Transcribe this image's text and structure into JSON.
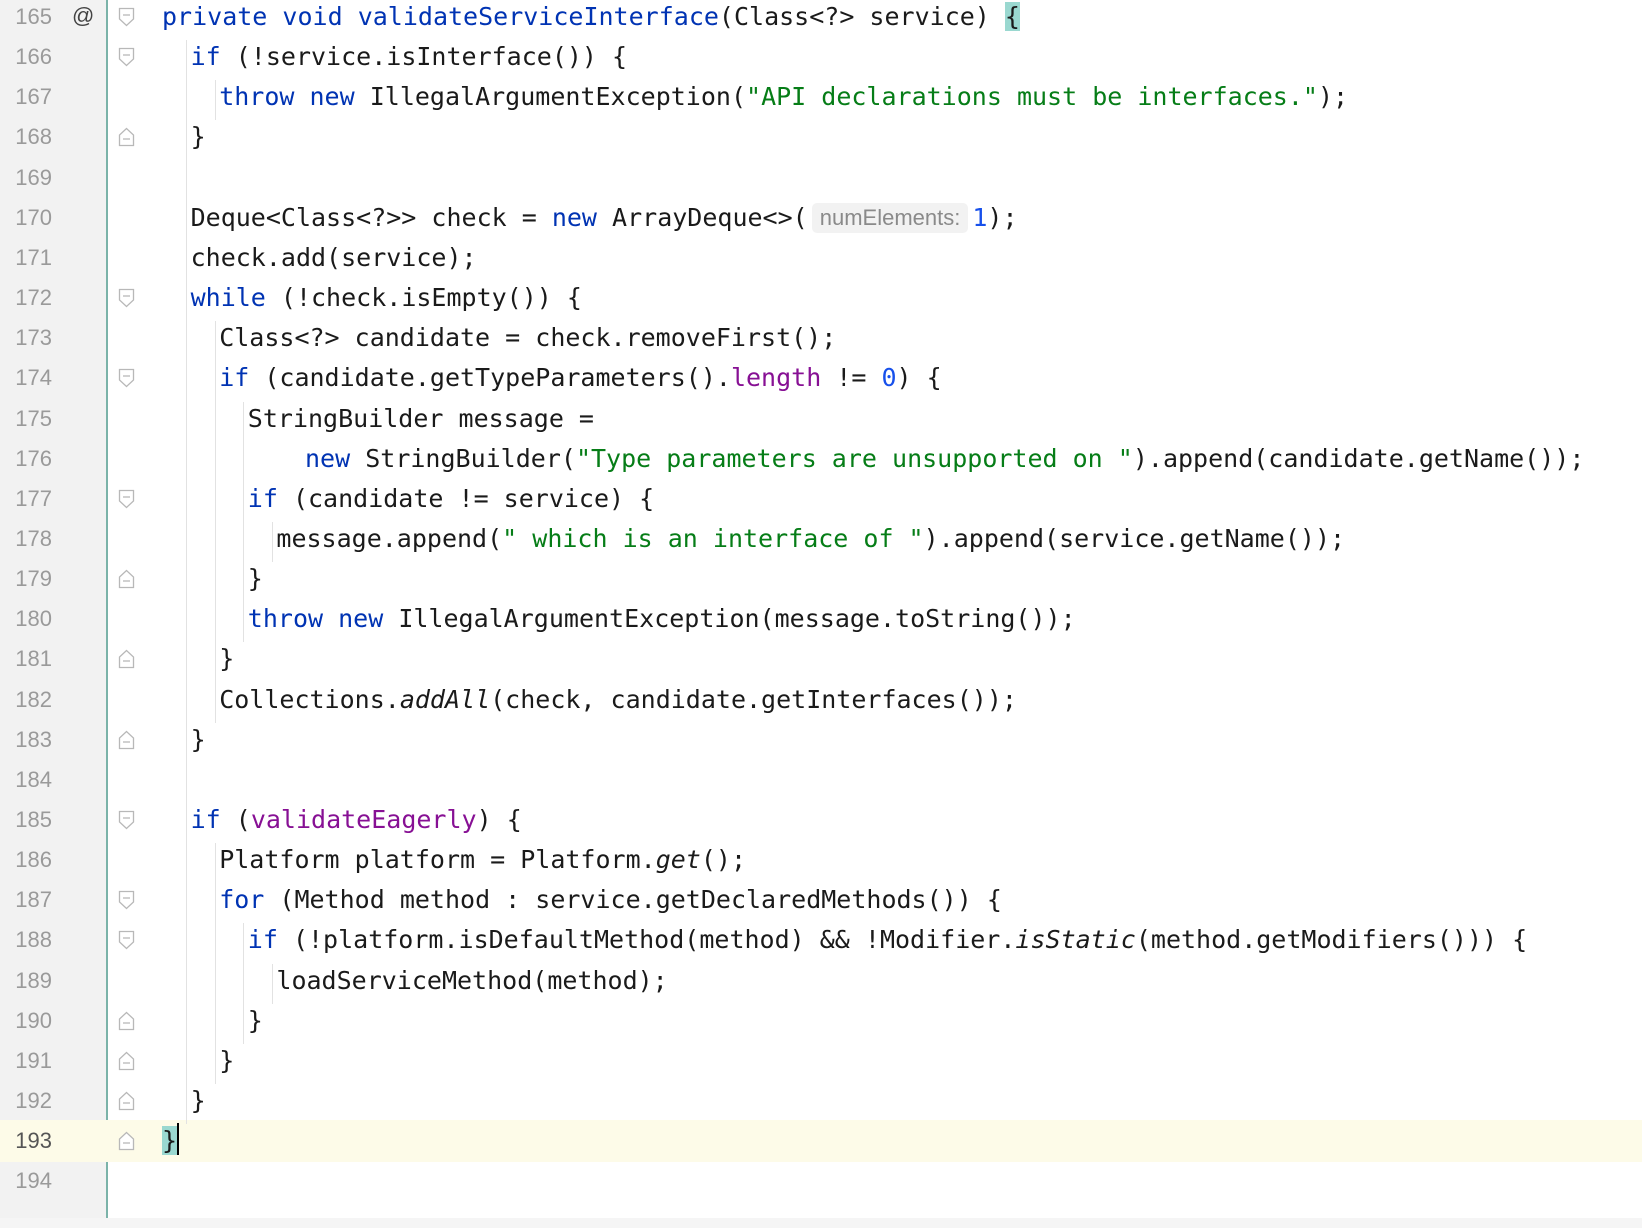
{
  "editor": {
    "lines": [
      {
        "no": "165",
        "marker": "@",
        "fold": "open",
        "indent": 0,
        "code": [
          [
            "kw",
            "private "
          ],
          [
            "kw",
            "void "
          ],
          [
            "fn",
            "validateServiceInterface"
          ],
          [
            "",
            "(Class<?> service) "
          ],
          [
            "hl",
            "{"
          ]
        ]
      },
      {
        "no": "166",
        "fold": "open",
        "indent": 1,
        "code": [
          [
            "kw",
            "if "
          ],
          [
            "",
            "(!service.isInterface()) {"
          ]
        ]
      },
      {
        "no": "167",
        "indent": 2,
        "code": [
          [
            "kw",
            "throw "
          ],
          [
            "kw",
            "new "
          ],
          [
            "",
            "IllegalArgumentException("
          ],
          [
            "str",
            "\"API declarations must be interfaces.\""
          ],
          [
            "",
            ");"
          ]
        ]
      },
      {
        "no": "168",
        "fold": "close",
        "indent": 1,
        "code": [
          [
            "",
            "}"
          ]
        ]
      },
      {
        "no": "169",
        "indent": 0,
        "code": []
      },
      {
        "no": "170",
        "indent": 1,
        "code": [
          [
            "",
            "Deque<Class<?>> check = "
          ],
          [
            "kw",
            "new "
          ],
          [
            "",
            "ArrayDeque<>("
          ],
          [
            "hint",
            "numElements:"
          ],
          [
            "num",
            "1"
          ],
          [
            "",
            ");"
          ]
        ]
      },
      {
        "no": "171",
        "indent": 1,
        "code": [
          [
            "",
            "check.add(service);"
          ]
        ]
      },
      {
        "no": "172",
        "fold": "open",
        "indent": 1,
        "code": [
          [
            "kw",
            "while "
          ],
          [
            "",
            "(!check.isEmpty()) {"
          ]
        ]
      },
      {
        "no": "173",
        "indent": 2,
        "code": [
          [
            "",
            "Class<?> candidate = check.removeFirst();"
          ]
        ]
      },
      {
        "no": "174",
        "fold": "open",
        "indent": 2,
        "code": [
          [
            "kw",
            "if "
          ],
          [
            "",
            "(candidate.getTypeParameters()."
          ],
          [
            "field",
            "length"
          ],
          [
            "",
            " != "
          ],
          [
            "num",
            "0"
          ],
          [
            "",
            ") {"
          ]
        ]
      },
      {
        "no": "175",
        "indent": 3,
        "code": [
          [
            "",
            "StringBuilder message ="
          ]
        ]
      },
      {
        "no": "176",
        "indent": 5,
        "code": [
          [
            "kw",
            "new "
          ],
          [
            "",
            "StringBuilder("
          ],
          [
            "str",
            "\"Type parameters are unsupported on \""
          ],
          [
            "",
            ").append(candidate.getName());"
          ]
        ]
      },
      {
        "no": "177",
        "fold": "open",
        "indent": 3,
        "code": [
          [
            "kw",
            "if "
          ],
          [
            "",
            "(candidate != service) {"
          ]
        ]
      },
      {
        "no": "178",
        "indent": 4,
        "code": [
          [
            "",
            "message.append("
          ],
          [
            "str",
            "\" which is an interface of \""
          ],
          [
            "",
            ").append(service.getName());"
          ]
        ]
      },
      {
        "no": "179",
        "fold": "close",
        "indent": 3,
        "code": [
          [
            "",
            "}"
          ]
        ]
      },
      {
        "no": "180",
        "indent": 3,
        "code": [
          [
            "kw",
            "throw "
          ],
          [
            "kw",
            "new "
          ],
          [
            "",
            "IllegalArgumentException(message.toString());"
          ]
        ]
      },
      {
        "no": "181",
        "fold": "close",
        "indent": 2,
        "code": [
          [
            "",
            "}"
          ]
        ]
      },
      {
        "no": "182",
        "indent": 2,
        "code": [
          [
            "",
            "Collections."
          ],
          [
            "it",
            "addAll"
          ],
          [
            "",
            "(check, candidate.getInterfaces());"
          ]
        ]
      },
      {
        "no": "183",
        "fold": "close",
        "indent": 1,
        "code": [
          [
            "",
            "}"
          ]
        ]
      },
      {
        "no": "184",
        "indent": 0,
        "code": []
      },
      {
        "no": "185",
        "fold": "open",
        "indent": 1,
        "code": [
          [
            "kw",
            "if "
          ],
          [
            "",
            "("
          ],
          [
            "field",
            "validateEagerly"
          ],
          [
            "",
            ") {"
          ]
        ]
      },
      {
        "no": "186",
        "indent": 2,
        "code": [
          [
            "",
            "Platform platform = Platform."
          ],
          [
            "it",
            "get"
          ],
          [
            "",
            "();"
          ]
        ]
      },
      {
        "no": "187",
        "fold": "open",
        "indent": 2,
        "code": [
          [
            "kw",
            "for "
          ],
          [
            "",
            "(Method method : service.getDeclaredMethods()) {"
          ]
        ]
      },
      {
        "no": "188",
        "fold": "open",
        "indent": 3,
        "code": [
          [
            "kw",
            "if "
          ],
          [
            "",
            "(!platform.isDefaultMethod(method) && !Modifier."
          ],
          [
            "it",
            "isStatic"
          ],
          [
            "",
            "(method.getModifiers())) {"
          ]
        ]
      },
      {
        "no": "189",
        "indent": 4,
        "code": [
          [
            "",
            "loadServiceMethod(method);"
          ]
        ]
      },
      {
        "no": "190",
        "fold": "close",
        "indent": 3,
        "code": [
          [
            "",
            "}"
          ]
        ]
      },
      {
        "no": "191",
        "fold": "close",
        "indent": 2,
        "code": [
          [
            "",
            "}"
          ]
        ]
      },
      {
        "no": "192",
        "fold": "close",
        "indent": 1,
        "code": [
          [
            "",
            "}"
          ]
        ]
      },
      {
        "no": "193",
        "fold": "close",
        "indent": 0,
        "current": true,
        "code": [
          [
            "caretbrace",
            "}"
          ]
        ]
      },
      {
        "no": "194",
        "indent": 0,
        "code": []
      }
    ],
    "colors": {
      "keyword": "#0033b3",
      "string": "#067d17",
      "number": "#1750eb",
      "field": "#871094",
      "current_line": "#fdfbe8",
      "brace_match": "#9ad8d0"
    }
  }
}
